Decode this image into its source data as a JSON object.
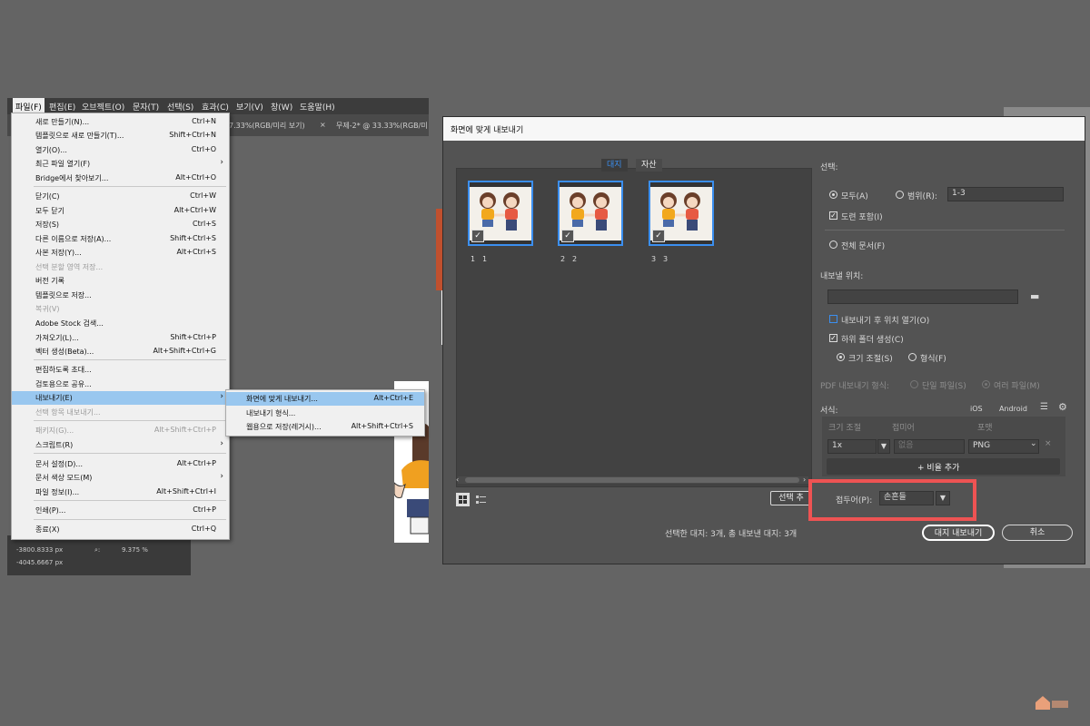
{
  "menubar": [
    "파일(F)",
    "편집(E)",
    "오브젝트(O)",
    "문자(T)",
    "선택(S)",
    "효과(C)",
    "보기(V)",
    "창(W)",
    "도움말(H)"
  ],
  "doc_tabs": [
    "7.33%(RGB/미리 보기)",
    "×",
    "무제-2* @ 33.33%(RGB/미"
  ],
  "file_menu": [
    {
      "label": "새로 만들기(N)...",
      "shortcut": "Ctrl+N"
    },
    {
      "label": "템플릿으로 새로 만들기(T)...",
      "shortcut": "Shift+Ctrl+N"
    },
    {
      "label": "열기(O)...",
      "shortcut": "Ctrl+O"
    },
    {
      "label": "최근 파일 열기(F)",
      "shortcut": "›"
    },
    {
      "label": "Bridge에서 찾아보기...",
      "shortcut": "Alt+Ctrl+O"
    },
    {
      "label": "닫기(C)",
      "shortcut": "Ctrl+W"
    },
    {
      "label": "모두 닫기",
      "shortcut": "Alt+Ctrl+W"
    },
    {
      "label": "저장(S)",
      "shortcut": "Ctrl+S"
    },
    {
      "label": "다른 이름으로 저장(A)...",
      "shortcut": "Shift+Ctrl+S"
    },
    {
      "label": "사본 저장(Y)...",
      "shortcut": "Alt+Ctrl+S"
    },
    {
      "label": "선택 분할 영역 저장...",
      "shortcut": ""
    },
    {
      "label": "버전 기록",
      "shortcut": ""
    },
    {
      "label": "템플릿으로 저장...",
      "shortcut": ""
    },
    {
      "label": "복귀(V)",
      "shortcut": ""
    },
    {
      "label": "Adobe Stock 검색...",
      "shortcut": ""
    },
    {
      "label": "가져오기(L)...",
      "shortcut": "Shift+Ctrl+P"
    },
    {
      "label": "벡터 생성(Beta)...",
      "shortcut": "Alt+Shift+Ctrl+G"
    },
    {
      "label": "편집하도록 초대...",
      "shortcut": ""
    },
    {
      "label": "검토용으로 공유...",
      "shortcut": ""
    },
    {
      "label": "내보내기(E)",
      "shortcut": "›"
    },
    {
      "label": "선택 항목 내보내기...",
      "shortcut": ""
    },
    {
      "label": "패키지(G)...",
      "shortcut": "Alt+Shift+Ctrl+P"
    },
    {
      "label": "스크립트(R)",
      "shortcut": "›"
    },
    {
      "label": "문서 설정(D)...",
      "shortcut": "Alt+Ctrl+P"
    },
    {
      "label": "문서 색상 모드(M)",
      "shortcut": "›"
    },
    {
      "label": "파일 정보(I)...",
      "shortcut": "Alt+Shift+Ctrl+I"
    },
    {
      "label": "인쇄(P)...",
      "shortcut": "Ctrl+P"
    },
    {
      "label": "종료(X)",
      "shortcut": "Ctrl+Q"
    }
  ],
  "export_submenu": [
    {
      "label": "화면에 맞게 내보내기...",
      "shortcut": "Alt+Ctrl+E"
    },
    {
      "label": "내보내기 형식...",
      "shortcut": ""
    },
    {
      "label": "웹용으로 저장(레거시)...",
      "shortcut": "Alt+Shift+Ctrl+S"
    }
  ],
  "left_panel": {
    "x_value": "-3800.8333 px",
    "y_value": "-4045.6667 px",
    "zoom_value": "9.375 %"
  },
  "dialog": {
    "title": "화면에 맞게 내보내기",
    "tabs": [
      "대지",
      "자산"
    ],
    "artboards": [
      {
        "index": "1",
        "name": "1"
      },
      {
        "index": "2",
        "name": "2"
      },
      {
        "index": "3",
        "name": "3"
      }
    ],
    "selection_label": "선택:",
    "all_label": "모두(A)",
    "range_label": "범위(R):",
    "range_value": "1-3",
    "include_bleed_label": "도련 포함(I)",
    "full_doc_label": "전체 문서(F)",
    "export_location_label": "내보낼 위치:",
    "location_value": "",
    "open_after_label": "내보내기 후 위치 열기(O)",
    "subfolders_label": "하위 폴더 생성(C)",
    "by_size_label": "크기 조절(S)",
    "by_format_label": "형식(F)",
    "pdf_label": "PDF 내보내기 형식:",
    "pdf_single": "단일 파일(S)",
    "pdf_multiple": "여러 파일(M)",
    "formats_label": "서식:",
    "ios_label": "iOS",
    "android_label": "Android",
    "col_scale": "크기 조절",
    "col_suffix": "접미어",
    "col_format": "포맷",
    "scale_value": "1x",
    "suffix_placeholder": "없음",
    "format_value": "PNG",
    "add_scale_label": "+ 비율 추가",
    "select_button": "선택 추",
    "prefix_label": "접두어(P):",
    "prefix_value": "손흔들",
    "status_text": "선택한 대지: 3개, 총 내보낸 대지: 3개",
    "export_button": "대지 내보내기",
    "cancel_button": "취소"
  },
  "colors": {
    "highlight": "#99c7ef",
    "accent": "#3b8ff0",
    "annotation": "#ee5353"
  }
}
